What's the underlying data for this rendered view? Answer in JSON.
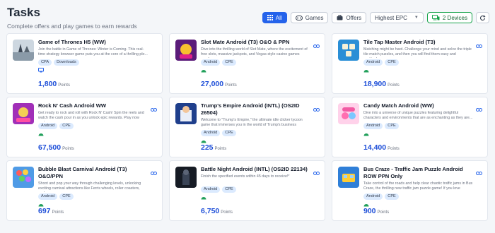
{
  "page": {
    "title": "Tasks",
    "subtitle": "Complete offers and play games to earn rewards"
  },
  "toolbar": {
    "all_label": "All",
    "games_label": "Games",
    "offers_label": "Offers",
    "sort_value": "Highest EPC",
    "devices_label": "2 Devices"
  },
  "points_label": "Points",
  "colors": {
    "accent": "#2563eb",
    "points": "#1d4ed8",
    "tag_bg": "#dbeafe",
    "android": "#22a05b"
  },
  "cards": [
    {
      "title": "Game of Thrones H5 (WW)",
      "desc": "Join the battle in Game of Thrones: Winter is Coming. This real-time strategy browser game puts you at the core of a thrilling plo...",
      "tags": [
        "CPA",
        "Downloads"
      ],
      "platform": "desktop-icon",
      "points": "1,800",
      "corner": false
    },
    {
      "title": "Slot Mate Android (T3) O&O & PPN",
      "desc": "Dive into the thrilling world of Slot Mate, where the excitement of free slots, massive jackpots, and Vegas-style casino games awaits...",
      "tags": [
        "Android",
        "CPE"
      ],
      "platform": "android-icon",
      "points": "27,000",
      "corner": true
    },
    {
      "title": "Tile Tap Master Android (T3)",
      "desc": "Matching might be hard. Challenge your mind and solve the triple tile match puzzles, and then you will find them easy and exciting!...",
      "tags": [
        "Android",
        "CPE"
      ],
      "platform": "android-icon",
      "points": "18,900",
      "corner": true
    },
    {
      "title": "Rock N' Cash Android WW",
      "desc": "Get ready to rock and roll with Rock N' Cash! Spin the reels and watch the cash pour in as you unlock epic rewards. Play now and...",
      "tags": [
        "Android",
        "CPE"
      ],
      "platform": "android-icon",
      "points": "67,500",
      "corner": true
    },
    {
      "title": "Trump's Empire Android (INTL) (OS2ID 26504)",
      "desc": "Welcome to \"Trump's Empire,\" the ultimate idle clicker tycoon game that immerses you in the world of Trump's business empire...",
      "tags": [
        "Android",
        "CPE"
      ],
      "platform": "android-icon",
      "points": "225",
      "corner": true
    },
    {
      "title": "Candy Match Android (WW)",
      "desc": "Dive into a universe of unique puzzles featuring delightful characters and environments that are as enchanting as they are...",
      "tags": [
        "Android",
        "CPE"
      ],
      "platform": "android-icon",
      "points": "14,400",
      "corner": true
    },
    {
      "title": "Bubble Blast Carnival Android (T3) O&O/PPN",
      "desc": "Shoot and pop your way through challenging levels, unlocking exciting carnival attractions like Ferris wheels, roller coasters, and...",
      "tags": [
        "Android",
        "CPE"
      ],
      "platform": "android-icon",
      "points": "697",
      "corner": true
    },
    {
      "title": "Battle Night Android (INTL) (OS2ID 22134)",
      "desc": "Finish the specified events within 45 days to receive!*",
      "tags": [
        "Android",
        "CPE"
      ],
      "platform": "android-icon",
      "points": "6,750",
      "corner": true
    },
    {
      "title": "Bus Craze - Traffic Jam Puzzle Android ROW PPN Only",
      "desc": "Take control of the roads and help clear chaotic traffic jams in Bus Craze, the thrilling new traffic jam puzzle game! If you love game...",
      "tags": [
        "Android",
        "CPE"
      ],
      "platform": "android-icon",
      "points": "900",
      "corner": true
    }
  ]
}
